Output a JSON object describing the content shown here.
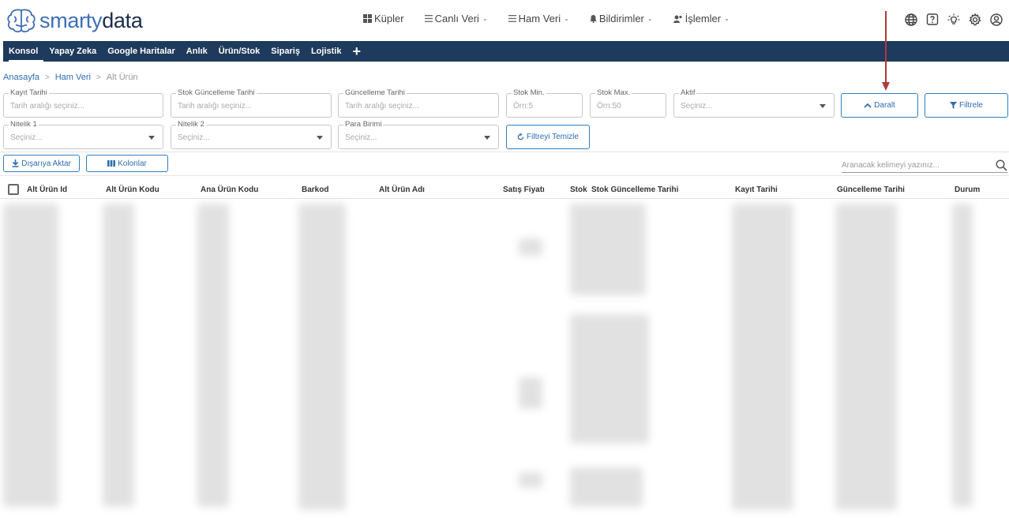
{
  "logo": {
    "part1": "smarty",
    "part2": "data"
  },
  "top_nav": [
    {
      "label": "Küpler",
      "icon": "cubes-icon",
      "dropdown": false
    },
    {
      "label": "Canlı Veri",
      "icon": "list-icon",
      "dropdown": true
    },
    {
      "label": "Ham Veri",
      "icon": "list-icon",
      "dropdown": true
    },
    {
      "label": "Bildirimler",
      "icon": "bell-icon",
      "dropdown": true
    },
    {
      "label": "İşlemler",
      "icon": "users-icon",
      "dropdown": true
    }
  ],
  "main_tabs": [
    "Konsol",
    "Yapay Zeka",
    "Google Haritalar",
    "Anlık",
    "Ürün/Stok",
    "Sipariş",
    "Lojistik"
  ],
  "active_tab": "Konsol",
  "breadcrumb": {
    "home": "Anasayfa",
    "parent": "Ham Veri",
    "current": "Alt Ürün"
  },
  "filters": {
    "kayit_tarihi": {
      "label": "Kayıt Tarihi",
      "placeholder": "Tarih aralığı seçiniz..."
    },
    "stok_guncelleme_tarihi": {
      "label": "Stok Güncelleme Tarihi",
      "placeholder": "Tarih aralığı seçiniz..."
    },
    "guncelleme_tarihi": {
      "label": "Güncelleme Tarihi",
      "placeholder": "Tarih aralığı seçiniz..."
    },
    "stok_min": {
      "label": "Stok Min.",
      "placeholder": "Örn:5"
    },
    "stok_max": {
      "label": "Stok Max.",
      "placeholder": "Örn:50"
    },
    "aktif": {
      "label": "Aktif",
      "placeholder": "Seçiniz..."
    },
    "nitelik1": {
      "label": "Nitelik 1",
      "placeholder": "Seçiniz..."
    },
    "nitelik2": {
      "label": "Nitelik 2",
      "placeholder": "Seçiniz..."
    },
    "para_birimi": {
      "label": "Para Birimi",
      "placeholder": "Seçiniz..."
    }
  },
  "buttons": {
    "daralt": "Daralt",
    "filtrele": "Filtrele",
    "filtreyi_temizle": "Filtreyi Temizle",
    "disariya_aktar": "Dışarıya Aktar",
    "kolonlar": "Kolonlar"
  },
  "search": {
    "placeholder": "Aranacak kelimeyi yazınız..."
  },
  "table": {
    "columns": [
      "Alt Ürün Id",
      "Alt Ürün Kodu",
      "Ana Ürün Kodu",
      "Barkod",
      "Alt Ürün Adı",
      "Satış Fiyatı",
      "Stok",
      "Stok Güncelleme Tarihi",
      "Kayıt Tarihi",
      "Güncelleme Tarihi",
      "Durum"
    ]
  },
  "colors": {
    "primary": "#2f6db0",
    "nav_bg": "#1e3a5c",
    "arrow": "#b03a3a"
  }
}
